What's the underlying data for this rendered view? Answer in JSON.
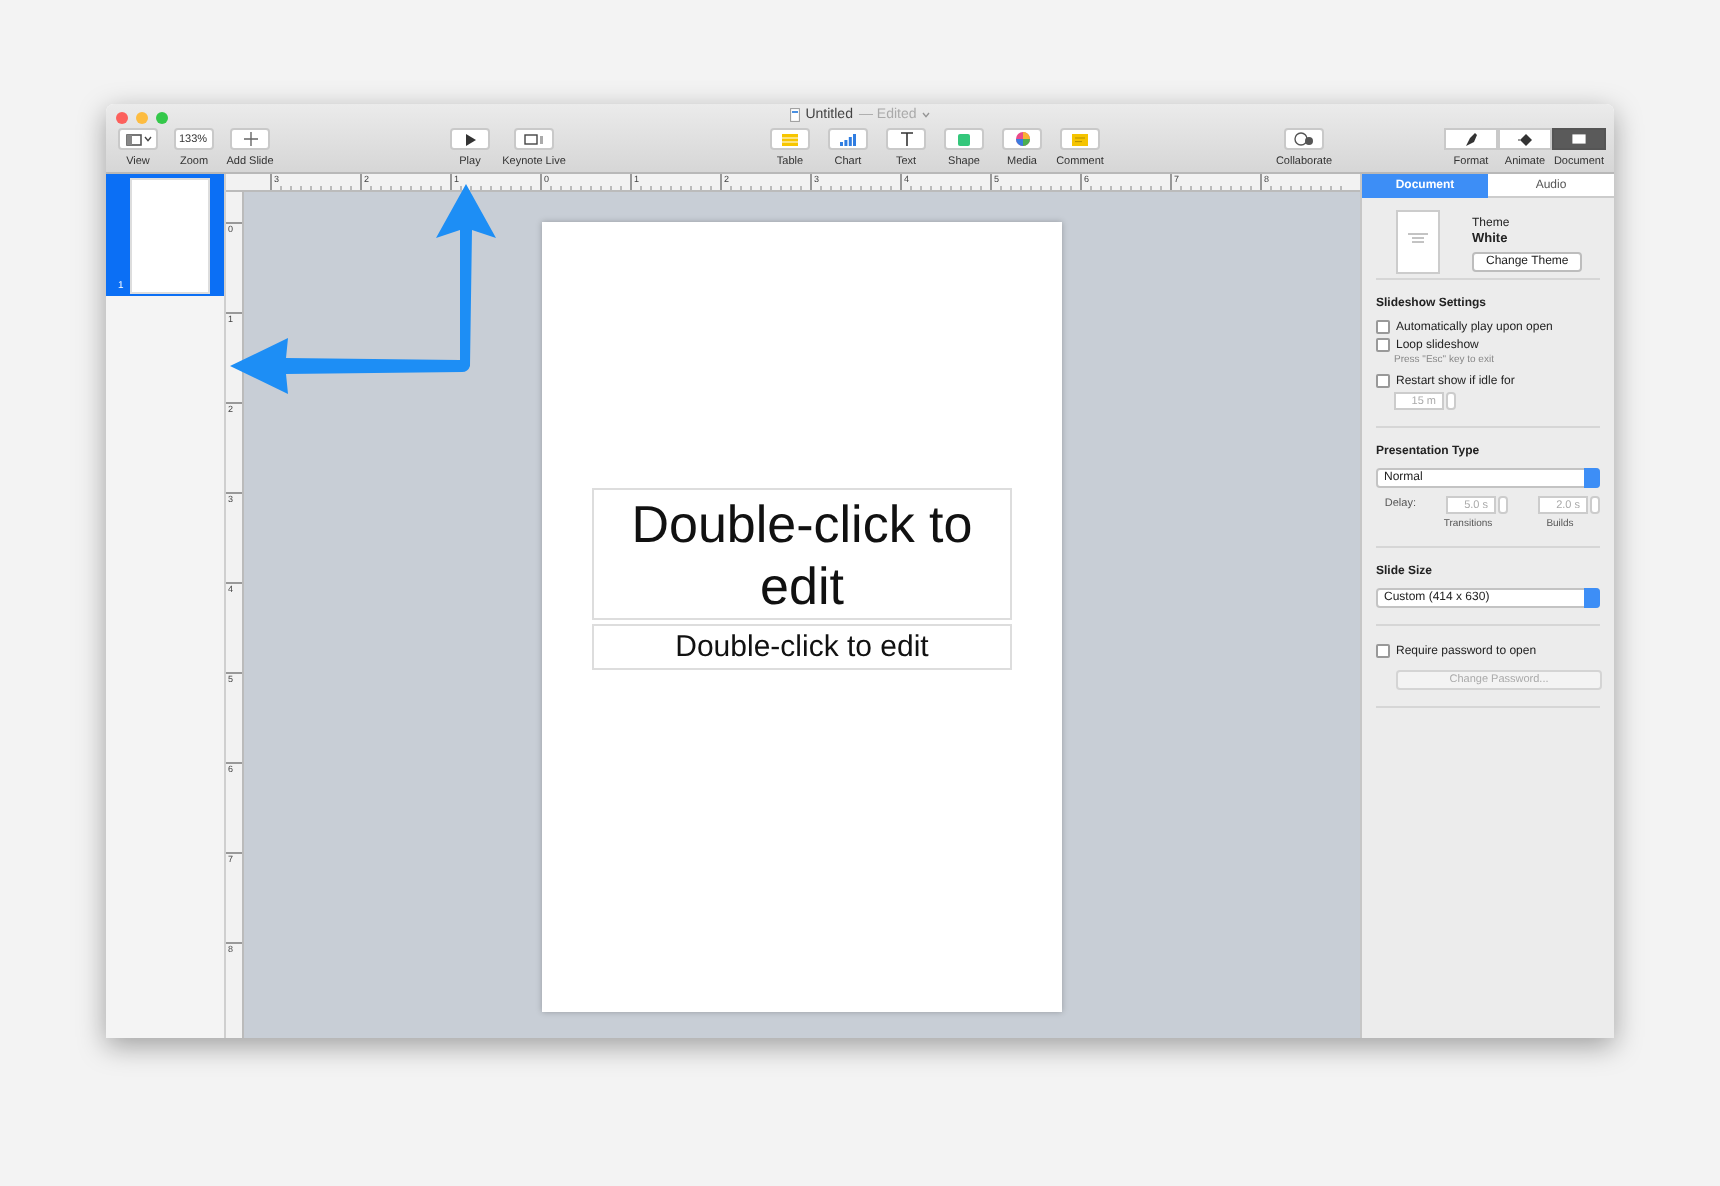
{
  "window": {
    "title": "Untitled",
    "subtitle": "— Edited"
  },
  "toolbar": {
    "groups": [
      {
        "items": [
          {
            "label": "View"
          },
          {
            "label": "Zoom",
            "value": "133%"
          },
          {
            "label": "Add Slide"
          }
        ]
      },
      {
        "items": [
          {
            "label": "Play"
          },
          {
            "label": "Keynote Live"
          }
        ]
      },
      {
        "items": [
          {
            "label": "Table"
          },
          {
            "label": "Chart"
          },
          {
            "label": "Text"
          },
          {
            "label": "Shape"
          },
          {
            "label": "Media"
          },
          {
            "label": "Comment"
          }
        ]
      },
      {
        "items": [
          {
            "label": "Collaborate"
          }
        ]
      }
    ],
    "inspector_buttons": [
      {
        "label": "Format",
        "selected": false
      },
      {
        "label": "Animate",
        "selected": false
      },
      {
        "label": "Document",
        "selected": true
      }
    ]
  },
  "sidebar": {
    "slides": [
      {
        "number": "1",
        "selected": true
      }
    ]
  },
  "rulers": {
    "horizontal": [
      "3",
      "2",
      "1",
      "0",
      "1",
      "2",
      "3",
      "4",
      "5",
      "6",
      "7",
      "8"
    ],
    "vertical": [
      "0",
      "1",
      "2",
      "3",
      "4",
      "5",
      "6",
      "7",
      "8"
    ]
  },
  "slide": {
    "title": "Double-click to edit",
    "body": "Double-click to edit"
  },
  "inspector": {
    "tabs": [
      {
        "label": "Document",
        "selected": true
      },
      {
        "label": "Audio",
        "selected": false
      }
    ],
    "theme": {
      "label": "Theme",
      "name": "White",
      "button": "Change Theme"
    },
    "slideshow": {
      "heading": "Slideshow Settings",
      "options": [
        {
          "label": "Automatically play upon open",
          "checked": false
        },
        {
          "label": "Loop slideshow",
          "checked": false,
          "hint": "Press \"Esc\" key to exit"
        },
        {
          "label": "Restart show if idle for",
          "checked": false
        }
      ],
      "idle": {
        "value": "15 m",
        "disabled": true
      }
    },
    "presentation_type": {
      "heading": "Presentation Type",
      "value": "Normal",
      "delay_label": "Delay:",
      "delays": [
        {
          "value": "5.0 s",
          "caption": "Transitions",
          "disabled": true
        },
        {
          "value": "2.0 s",
          "caption": "Builds",
          "disabled": true
        }
      ]
    },
    "slide_size": {
      "heading": "Slide Size",
      "value": "Custom (414 x 630)"
    },
    "password": {
      "label": "Require password to open",
      "checked": false,
      "button": "Change Password...",
      "disabled": true
    }
  }
}
